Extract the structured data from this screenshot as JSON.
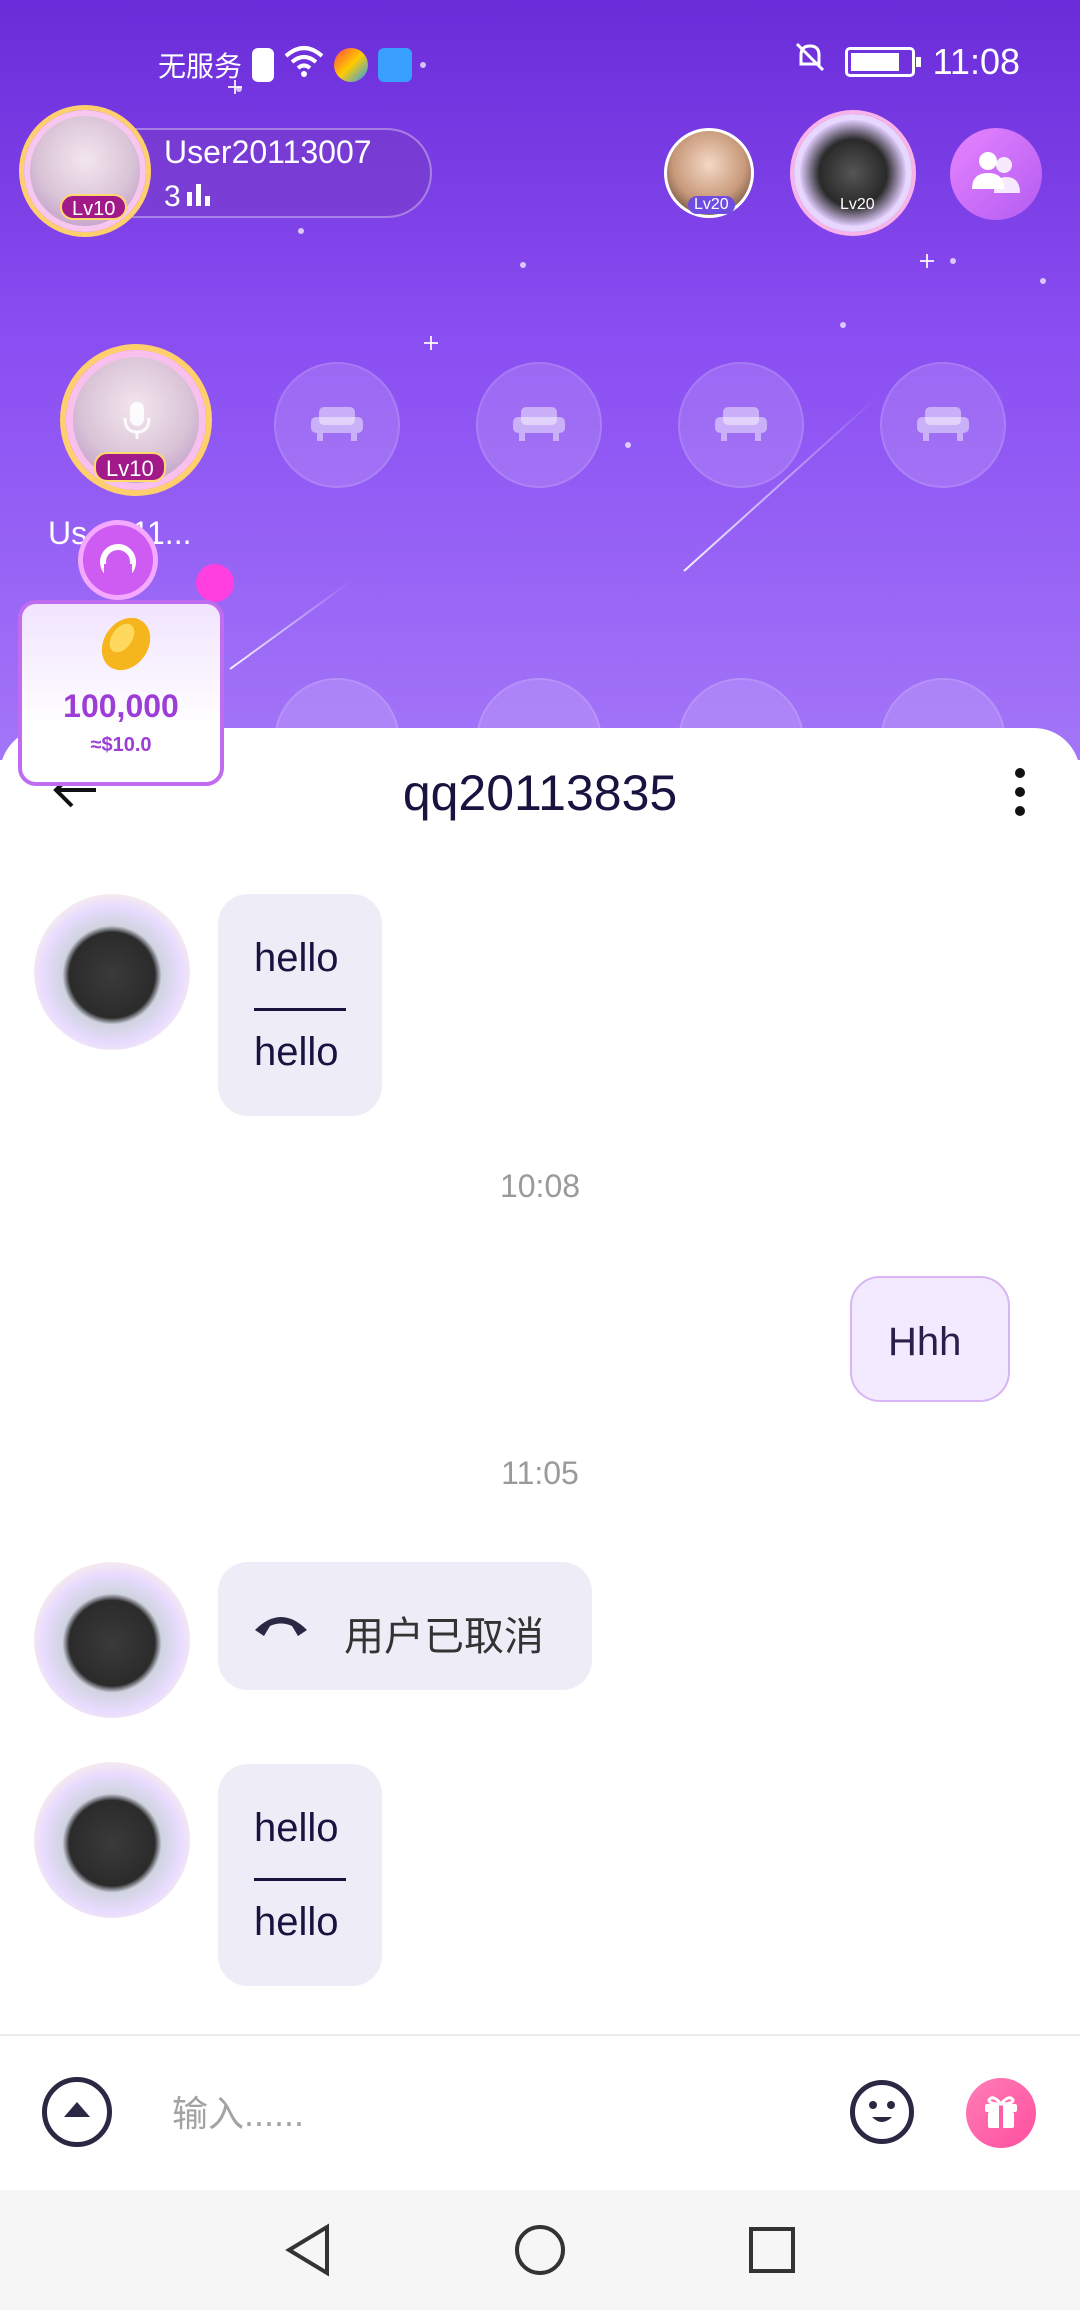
{
  "status_bar": {
    "carrier": "无服务",
    "time": "11:08"
  },
  "room": {
    "host": {
      "name": "User20113007",
      "count": "3",
      "level": "Lv10"
    },
    "viewers": [
      {
        "level": "Lv20"
      },
      {
        "level": "Lv20"
      }
    ],
    "main_seat": {
      "label": "Us...011...",
      "level": "Lv10"
    },
    "gift_card": {
      "amount": "100,000",
      "usd": "≈$10.0"
    }
  },
  "chat": {
    "title": "qq20113835",
    "messages": [
      {
        "type": "text-in",
        "line1": "hello",
        "line2": "hello"
      },
      {
        "type": "timestamp",
        "text": "10:08"
      },
      {
        "type": "text-out",
        "text": "Hhh"
      },
      {
        "type": "timestamp",
        "text": "11:05"
      },
      {
        "type": "call-in",
        "text": "用户已取消"
      },
      {
        "type": "text-in",
        "line1": "hello",
        "line2": "hello"
      }
    ]
  },
  "input": {
    "placeholder": "输入......"
  },
  "icons": {
    "back": "arrow-left-icon",
    "more": "more-vertical-icon",
    "expand": "chevron-up-icon",
    "emoji": "emoji-icon",
    "gift": "gift-icon",
    "phone": "phone-hangup-icon",
    "users": "users-icon",
    "seat": "sofa-icon"
  },
  "colors": {
    "room_top": "#6a2cd8",
    "room_bottom": "#a376f8",
    "bubble_in": "#eeedf7",
    "bubble_out": "#f3eaff",
    "gift_accent": "#9c3ed6"
  }
}
